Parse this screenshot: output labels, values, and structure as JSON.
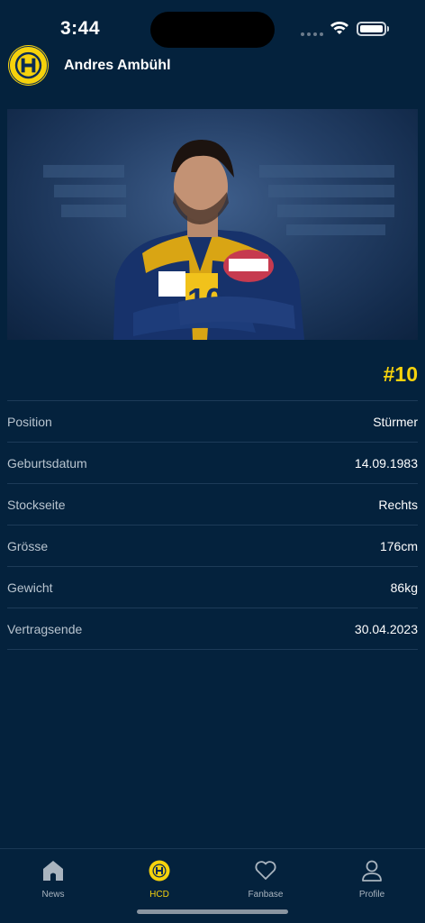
{
  "status_bar": {
    "time": "3:44"
  },
  "header": {
    "player_name": "Andres Ambühl",
    "logo_icon": "hcd-club-logo"
  },
  "player": {
    "number": "#10",
    "photo_icon": "player-photo"
  },
  "details": [
    {
      "label": "Position",
      "value": "Stürmer"
    },
    {
      "label": "Geburtsdatum",
      "value": "14.09.1983"
    },
    {
      "label": "Stockseite",
      "value": "Rechts"
    },
    {
      "label": "Grösse",
      "value": "176cm"
    },
    {
      "label": "Gewicht",
      "value": "86kg"
    },
    {
      "label": "Vertragsende",
      "value": "30.04.2023"
    }
  ],
  "tabs": [
    {
      "label": "News",
      "icon": "home-icon",
      "active": false
    },
    {
      "label": "HCD",
      "icon": "hcd-logo-icon",
      "active": true
    },
    {
      "label": "Fanbase",
      "icon": "heart-icon",
      "active": false
    },
    {
      "label": "Profile",
      "icon": "person-icon",
      "active": false
    }
  ],
  "colors": {
    "background": "#04223d",
    "accent": "#f6d20c",
    "divider": "#1d3b58"
  }
}
